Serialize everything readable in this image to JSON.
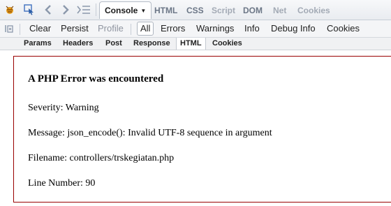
{
  "toolbar": {
    "icons": [
      "firebug-icon",
      "inspect-icon",
      "back-icon",
      "forward-icon",
      "command-line-icon"
    ],
    "tabs": [
      {
        "label": "Console",
        "active": true
      },
      {
        "label": "HTML"
      },
      {
        "label": "CSS"
      },
      {
        "label": "Script",
        "muted": true
      },
      {
        "label": "DOM"
      },
      {
        "label": "Net",
        "muted": true
      },
      {
        "label": "Cookies",
        "muted": true
      }
    ]
  },
  "console_bar": {
    "clear": "Clear",
    "persist": "Persist",
    "profile": "Profile",
    "filters": [
      "All",
      "Errors",
      "Warnings",
      "Info",
      "Debug Info",
      "Cookies"
    ]
  },
  "request_tabs": [
    "Params",
    "Headers",
    "Post",
    "Response",
    "HTML",
    "Cookies"
  ],
  "error": {
    "title": "A PHP Error was encountered",
    "severity": "Severity: Warning",
    "message": "Message: json_encode(): Invalid UTF-8 sequence in argument",
    "filename": "Filename: controllers/trskegiatan.php",
    "line": "Line Number: 90"
  },
  "colors": {
    "error_border": "#990000",
    "toolbar_bg": "#e9ecf0"
  }
}
